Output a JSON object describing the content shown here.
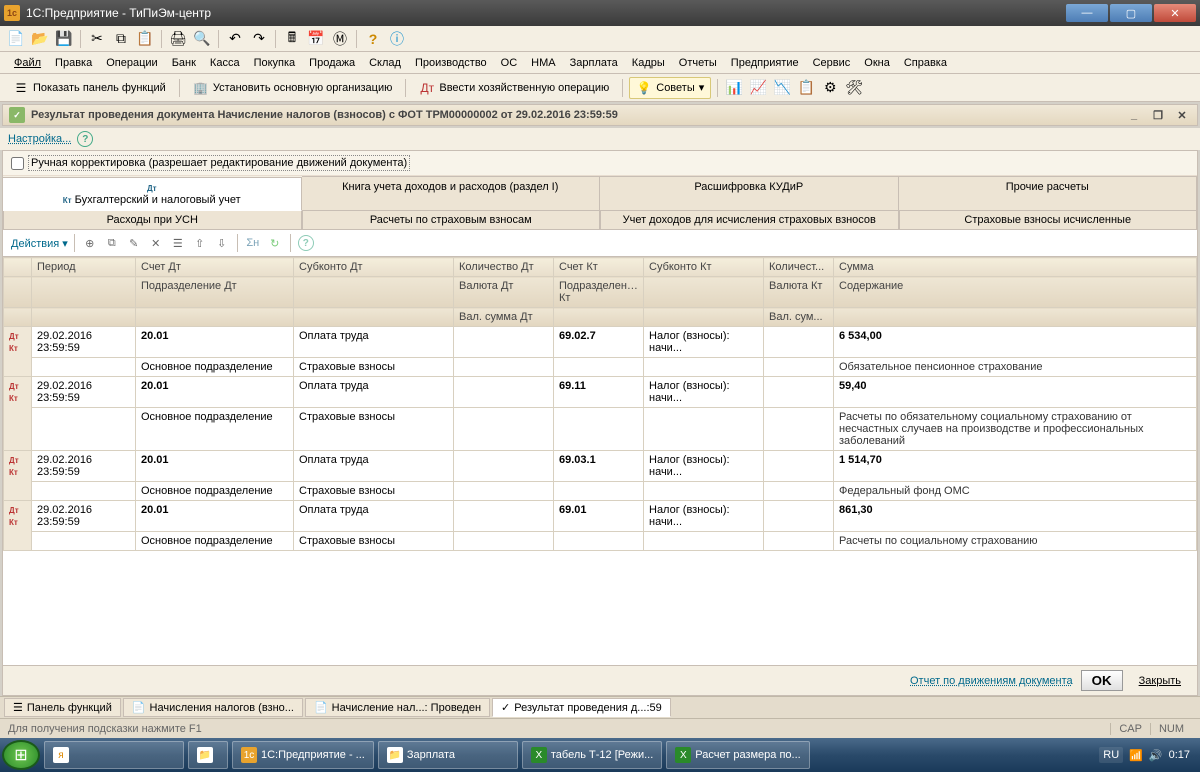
{
  "window": {
    "title": "1С:Предприятие - ТиПиЭм-центр"
  },
  "menu": {
    "file": "Файл",
    "edit": "Правка",
    "ops": "Операции",
    "bank": "Банк",
    "kassa": "Касса",
    "purchase": "Покупка",
    "sale": "Продажа",
    "warehouse": "Склад",
    "prod": "Производство",
    "os": "ОС",
    "nma": "НМА",
    "salary": "Зарплата",
    "kadry": "Кадры",
    "reports": "Отчеты",
    "enterprise": "Предприятие",
    "service": "Сервис",
    "windows": "Окна",
    "help": "Справка"
  },
  "toolbar2": {
    "show_panel": "Показать панель функций",
    "set_org": "Установить основную организацию",
    "enter_op": "Ввести хозяйственную операцию",
    "advice": "Советы"
  },
  "document": {
    "title": "Результат проведения документа Начисление налогов (взносов) с ФОТ ТРМ00000002 от 29.02.2016 23:59:59",
    "settings": "Настройка...",
    "manual_edit": "Ручная корректировка (разрешает редактирование движений документа)"
  },
  "tabs_top": {
    "t1": "Бухгалтерский и налоговый учет",
    "t2": "Книга учета доходов и расходов (раздел I)",
    "t3": "Расшифровка КУДиР",
    "t4": "Прочие расчеты"
  },
  "tabs_sub": {
    "s1": "Расходы при УСН",
    "s2": "Расчеты по страховым взносам",
    "s3": "Учет доходов для исчисления страховых взносов",
    "s4": "Страховые взносы исчисленные"
  },
  "actions": {
    "label": "Действия"
  },
  "grid": {
    "headers": {
      "period": "Период",
      "acc_dt": "Счет Дт",
      "sub_dt": "Субконто Дт",
      "qty_dt": "Количество Дт",
      "acc_kt": "Счет Кт",
      "sub_kt": "Субконто Кт",
      "qty_kt": "Количест...",
      "amount": "Сумма",
      "dept_dt": "Подразделение Дт",
      "curr_dt": "Валюта Дт",
      "dept_kt": "Подразделение Кт",
      "curr_kt": "Валюта Кт",
      "content": "Содержание",
      "valsum_dt": "Вал. сумма Дт",
      "valsum_kt": "Вал. сум..."
    },
    "rows": [
      {
        "date": "29.02.2016",
        "time": "23:59:59",
        "acc_dt": "20.01",
        "dept_dt": "Основное подразделение",
        "sub_dt1": "Оплата труда",
        "sub_dt2": "Страховые взносы",
        "acc_kt": "69.02.7",
        "sub_kt": "Налог (взносы): начи...",
        "amount": "6 534,00",
        "content": "Обязательное пенсионное страхование"
      },
      {
        "date": "29.02.2016",
        "time": "23:59:59",
        "acc_dt": "20.01",
        "dept_dt": "Основное подразделение",
        "sub_dt1": "Оплата труда",
        "sub_dt2": "Страховые взносы",
        "acc_kt": "69.11",
        "sub_kt": "Налог (взносы): начи...",
        "amount": "59,40",
        "content": "Расчеты по обязательному социальному страхованию от несчастных случаев на производстве и профессиональных заболеваний"
      },
      {
        "date": "29.02.2016",
        "time": "23:59:59",
        "acc_dt": "20.01",
        "dept_dt": "Основное подразделение",
        "sub_dt1": "Оплата труда",
        "sub_dt2": "Страховые взносы",
        "acc_kt": "69.03.1",
        "sub_kt": "Налог (взносы): начи...",
        "amount": "1 514,70",
        "content": "Федеральный фонд ОМС"
      },
      {
        "date": "29.02.2016",
        "time": "23:59:59",
        "acc_dt": "20.01",
        "dept_dt": "Основное подразделение",
        "sub_dt1": "Оплата труда",
        "sub_dt2": "Страховые взносы",
        "acc_kt": "69.01",
        "sub_kt": "Налог (взносы): начи...",
        "amount": "861,30",
        "content": "Расчеты по социальному страхованию"
      }
    ]
  },
  "footer": {
    "report_link": "Отчет по движениям документа",
    "ok": "OK",
    "close": "Закрыть"
  },
  "bottom_tabs": {
    "t1": "Панель функций",
    "t2": "Начисления налогов (взно...",
    "t3": "Начисление нал...: Проведен",
    "t4": "Результат проведения д...:59"
  },
  "statusbar": {
    "hint": "Для получения подсказки нажмите F1",
    "cap": "CAP",
    "num": "NUM"
  },
  "win_taskbar": {
    "items": [
      "1С:Предприятие - ...",
      "Зарплата",
      "табель Т-12  [Режи...",
      "Расчет размера по..."
    ],
    "lang": "RU",
    "time": "0:17"
  }
}
